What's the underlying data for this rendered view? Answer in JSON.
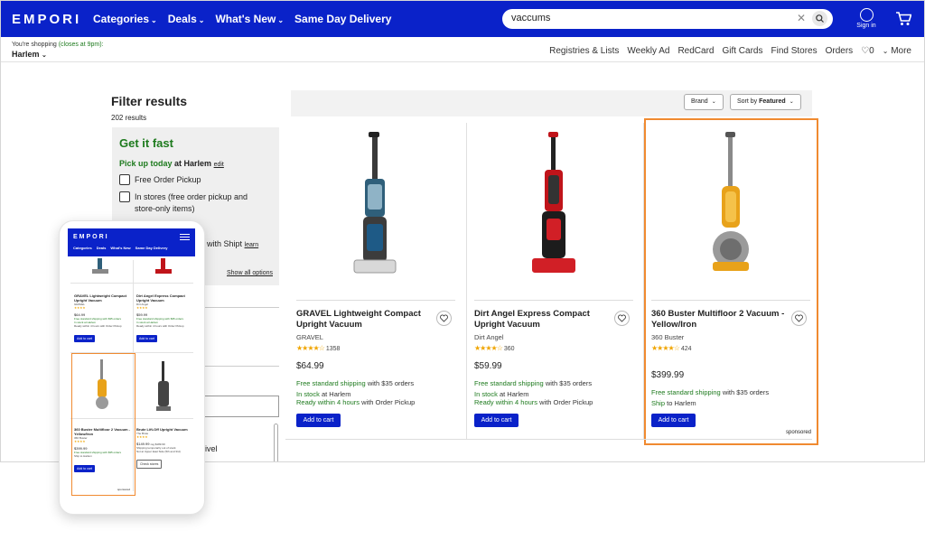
{
  "header": {
    "logo": "EMPORI",
    "nav": [
      "Categories",
      "Deals",
      "What's New",
      "Same Day Delivery"
    ],
    "search_value": "vaccums",
    "account_label": "Sign in",
    "colors": {
      "brand_blue": "#0a22c9",
      "highlight_orange": "#f08a30",
      "green": "#1d7a1d",
      "star": "#f0a500"
    }
  },
  "subheader": {
    "shopping_prefix": "You're shopping",
    "closes": "(closes at 9pm):",
    "store": "Harlem",
    "links": [
      "Registries & Lists",
      "Weekly Ad",
      "RedCard",
      "Gift Cards",
      "Find Stores",
      "Orders"
    ],
    "favorites_count": "0",
    "more": "More"
  },
  "filters": {
    "title": "Filter results",
    "result_count": "202 results",
    "get_it_fast": "Get it fast",
    "pickup_green": "Pick up today",
    "pickup_rest": "at Harlem",
    "edit": "edit",
    "options": [
      "Free Order Pickup",
      "In stores (free order pickup and",
      "store-only items)"
    ],
    "shipt_text": "with Shipt",
    "learn": "learn",
    "show_all": "Show all options",
    "partial_label": "ivel"
  },
  "sortbar": {
    "brand": "Brand",
    "sort_prefix": "Sort by",
    "sort_value": "Featured"
  },
  "products": [
    {
      "name": "GRAVEL Lightweight Compact Upright Vacuum",
      "brand": "GRAVEL",
      "rating": 4,
      "reviews": "1358",
      "price": "$64.99",
      "ship_green": "Free standard shipping",
      "ship_rest": "with $35 orders",
      "stock_green": "In stock",
      "stock_rest": "at Harlem",
      "ready_green": "Ready within 4 hours",
      "ready_rest": "with Order Pickup",
      "add": "Add to cart"
    },
    {
      "name": "Dirt Angel Express Compact Upright Vacuum",
      "brand": "Dirt Angel",
      "rating": 4,
      "reviews": "360",
      "price": "$59.99",
      "ship_green": "Free standard shipping",
      "ship_rest": "with $35 orders",
      "stock_green": "In stock",
      "stock_rest": "at Harlem",
      "ready_green": "Ready within 4 hours",
      "ready_rest": "with Order Pickup",
      "add": "Add to cart"
    },
    {
      "name": "360 Buster Multifloor 2 Vacuum - Yellow/Iron",
      "brand": "360 Buster",
      "rating": 4.5,
      "reviews": "424",
      "price": "$399.99",
      "ship_green": "Free standard shipping",
      "ship_rest": "with $35 orders",
      "ship_to_green": "Ship",
      "ship_to_rest": "to Harlem",
      "add": "Add to cart",
      "sponsored": "sponsored"
    }
  ],
  "mobile": {
    "logo": "EMPORI",
    "nav": [
      "Categories",
      "Deals",
      "What's New",
      "Same Day Delivery"
    ],
    "items": [
      {
        "name": "GRAVEL Lightweight Compact Upright Vacuum",
        "brand": "GRAVEL",
        "price": "$64.99",
        "ship": "Free standard shipping with $35 orders",
        "stock": "In stock at Harlem",
        "ready": "Ready within 4 hours with Order Pickup",
        "add": "Add to cart"
      },
      {
        "name": "Dirt Angel Express Compact Upright Vacuum",
        "brand": "Dirt Angel",
        "price": "$59.99",
        "ship": "Free standard shipping with $35 orders",
        "stock": "In stock at Harlem",
        "ready": "Ready within 4 hours with Order Pickup",
        "add": "Add to cart"
      },
      {
        "name": "360 Buster Multifloor 2 Vacuum - Yellow/Iron",
        "brand": "360 Buster",
        "price": "$399.99",
        "ship": "Free standard shipping with $35 orders",
        "ship_to": "Ship to Harlem",
        "add": "Add to cart",
        "sponsored": "sponsored"
      },
      {
        "name": "Brute Lift-Off Upright Vacuum",
        "brand": "The Brute",
        "price": "$149.99",
        "price_note": "reg $189.99",
        "ship": "Shipping temporarily out of stock",
        "stock": "Not at Upper East Side (5th and 3rd)",
        "add": "Check stores"
      }
    ]
  }
}
